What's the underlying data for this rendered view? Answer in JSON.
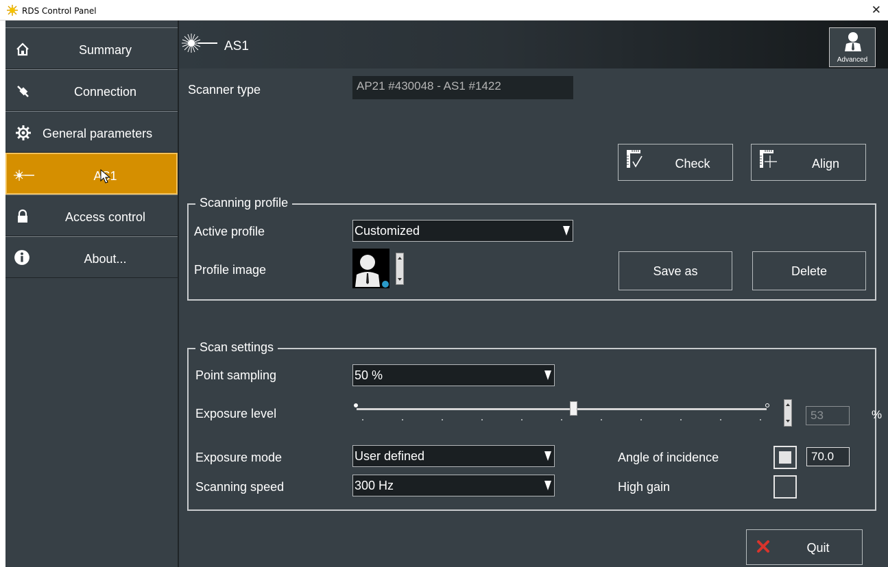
{
  "window": {
    "title": "RDS Control Panel",
    "close_glyph": "✕"
  },
  "sidebar": {
    "items": [
      {
        "label": "Summary",
        "icon": "home-icon"
      },
      {
        "label": "Connection",
        "icon": "plug-icon"
      },
      {
        "label": "General parameters",
        "icon": "gear-icon"
      },
      {
        "label": "AS1",
        "icon": "laser-icon",
        "active": true
      },
      {
        "label": "Access control",
        "icon": "lock-icon"
      },
      {
        "label": "About...",
        "icon": "info-icon"
      }
    ]
  },
  "header": {
    "title": "AS1",
    "advanced_label": "Advanced"
  },
  "scanner": {
    "type_label": "Scanner type",
    "type_value": "AP21 #430048 - AS1 #1422"
  },
  "toolbar": {
    "check_label": "Check",
    "align_label": "Align"
  },
  "scanning_profile": {
    "legend": "Scanning profile",
    "active_profile_label": "Active profile",
    "active_profile_value": "Customized",
    "profile_image_label": "Profile image",
    "save_as_label": "Save as",
    "delete_label": "Delete"
  },
  "scan_settings": {
    "legend": "Scan settings",
    "point_sampling_label": "Point sampling",
    "point_sampling_value": "50 %",
    "exposure_level_label": "Exposure level",
    "exposure_level_value": "53",
    "exposure_level_unit": "%",
    "exposure_level_percent": 53,
    "exposure_mode_label": "Exposure mode",
    "exposure_mode_value": "User defined",
    "scanning_speed_label": "Scanning speed",
    "scanning_speed_value": "300 Hz",
    "angle_label": "Angle of incidence",
    "angle_value": "70.0",
    "angle_checked": true,
    "high_gain_label": "High gain",
    "high_gain_checked": false
  },
  "footer": {
    "quit_label": "Quit"
  },
  "colors": {
    "accent": "#d58f00",
    "panel": "#374046",
    "quit_x": "#d8342c"
  }
}
